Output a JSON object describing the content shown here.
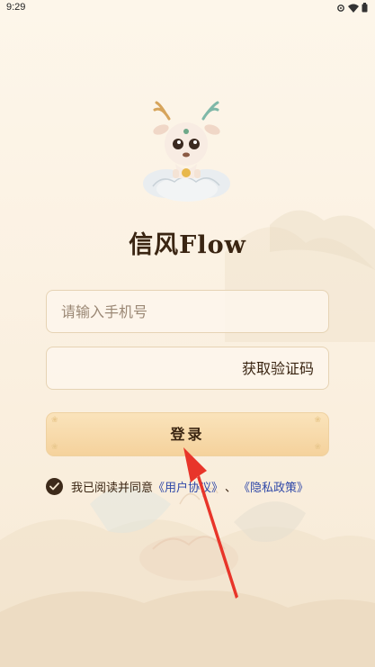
{
  "status_bar": {
    "time": "9:29",
    "icons": [
      "settings-icon",
      "wifi-icon",
      "battery-icon"
    ]
  },
  "app": {
    "title": "信风Flow"
  },
  "form": {
    "phone_placeholder": "请输入手机号",
    "code_placeholder": "",
    "get_code_label": "获取验证码",
    "login_label": "登录"
  },
  "agreement": {
    "prefix": "我已阅读并同意",
    "user_agreement": "《用户协议》",
    "separator": "、",
    "privacy_policy": "《隐私政策》",
    "checked": true
  },
  "colors": {
    "background": "#fcf4e6",
    "title": "#3a2512",
    "button": "#f5d29c",
    "link": "#2f48a8",
    "annotation_arrow": "#e8352a"
  }
}
